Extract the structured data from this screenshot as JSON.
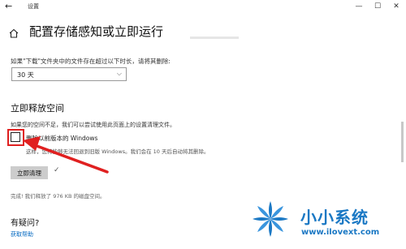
{
  "window": {
    "title": "设置",
    "back_icon": "←",
    "min_icon": "—",
    "max_icon": "☐",
    "close_icon": "✕"
  },
  "page": {
    "title": "配置存储感知或立即运行",
    "home_icon": "home-icon"
  },
  "download_section": {
    "label": "如果\"下载\"文件夹中的文件存在超过以下时长，请将其删除:",
    "selected": "30 天",
    "chevron": "⌵"
  },
  "free_now": {
    "heading": "立即释放空间",
    "description": "如果您的空间不足，我们可以尝试使用此页面上的设置清理文件。",
    "checkbox_label": "删除以前版本的 Windows",
    "checkbox_checked": false,
    "checkbox_sub": "这样，您将能够无法回退到旧版 Windows。我们会在 10 天后自动将其删除。",
    "button_label": "立即清理",
    "check_mark": "✓",
    "done_text": "完成! 我们释放了 976 KB 的磁盘空间。"
  },
  "help": {
    "heading": "有疑问?",
    "link": "获取帮助"
  },
  "watermark": {
    "name": "小小系统",
    "url": "www.ilovext.com"
  },
  "colors": {
    "accent": "#0067c0",
    "annotation": "#e02020",
    "watermark": "#1a78c4"
  }
}
